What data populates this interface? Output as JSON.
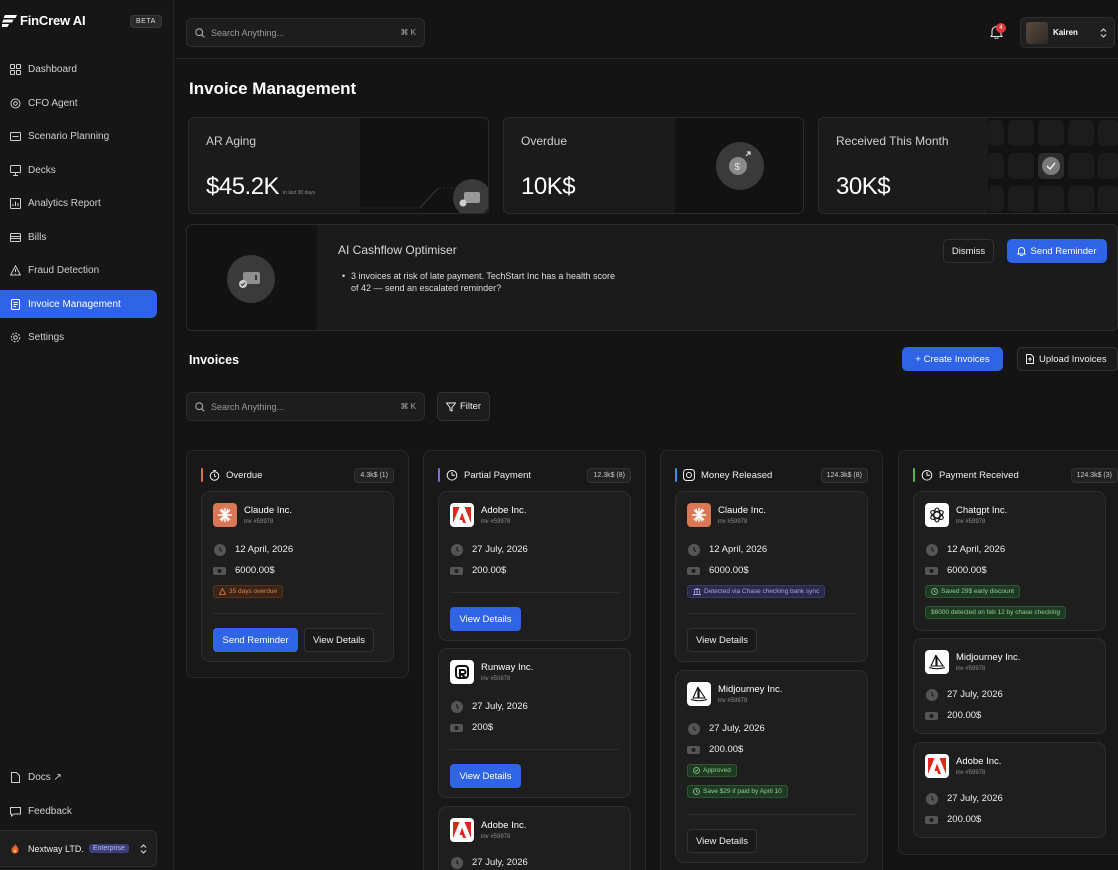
{
  "app": {
    "name": "FinCrew AI",
    "beta": "BETA"
  },
  "sidebar": {
    "items": [
      {
        "label": "Dashboard",
        "icon": "grid-icon"
      },
      {
        "label": "CFO Agent",
        "icon": "agent-icon"
      },
      {
        "label": "Scenario Planning",
        "icon": "scenario-icon"
      },
      {
        "label": "Decks",
        "icon": "presentation-icon"
      },
      {
        "label": "Analytics Report",
        "icon": "analytics-icon"
      },
      {
        "label": "Bills",
        "icon": "wallet-icon"
      },
      {
        "label": "Fraud Detection",
        "icon": "warning-icon"
      },
      {
        "label": "Invoice Management",
        "icon": "invoice-icon",
        "active": true
      },
      {
        "label": "Settings",
        "icon": "gear-icon"
      }
    ],
    "footer": {
      "docs": "Docs ↗",
      "feedback": "Feedback"
    },
    "org": {
      "name": "Nextway LTD.",
      "plan": "Enterprise"
    }
  },
  "topbar": {
    "search_placeholder": "Search Anything...",
    "search_shortcut": "⌘ K",
    "notifications": "4",
    "user": "Kairen"
  },
  "page": {
    "title": "Invoice Management"
  },
  "stats": [
    {
      "label": "AR Aging",
      "value": "$45.2K",
      "sub": "in last 30 days"
    },
    {
      "label": "Overdue",
      "value": "10K$"
    },
    {
      "label": "Received This Month",
      "value": "30K$"
    }
  ],
  "optimiser": {
    "title": "AI Cashflow Optimiser",
    "text": "3 invoices at risk of late payment. TechStart Inc has a health score of 42 — send an escalated reminder?",
    "dismiss": "Dismiss",
    "send": "Send Reminder"
  },
  "invoices": {
    "title": "Invoices",
    "create": "+ Create Invoices",
    "upload": "Upload Invoices",
    "search_placeholder": "Search Anything...",
    "search_shortcut": "⌘ K",
    "filter": "Filter"
  },
  "columns": [
    {
      "title": "Overdue",
      "total": "4.3k$ (1)",
      "color": "#e0732e",
      "cards": [
        {
          "name": "Claude Inc.",
          "inv": "inv #59978",
          "date": "12 April, 2026",
          "amount": "6000.00$",
          "tag": "35 days overdue",
          "primary": "Send Reminder",
          "secondary": "View Details"
        }
      ]
    },
    {
      "title": "Partial Payment",
      "total": "12.3k$ (8)",
      "color": "#7a6fe0",
      "cards": [
        {
          "name": "Adobe Inc.",
          "inv": "inv #59978",
          "date": "27 July, 2026",
          "amount": "200.00$",
          "primary": "View Details"
        },
        {
          "name": "Runway Inc.",
          "inv": "inv #50878",
          "date": "27 July, 2026",
          "amount": "200$",
          "primary": "View Details"
        },
        {
          "name": "Adobe Inc.",
          "inv": "inv #59978",
          "date": "27 July, 2026"
        }
      ]
    },
    {
      "title": "Money Released",
      "total": "124.3k$ (8)",
      "color": "#3a8ee8",
      "cards": [
        {
          "name": "Claude Inc.",
          "inv": "inv #59978",
          "date": "12 April, 2026",
          "amount": "6000.00$",
          "tag": "Detected via Chase checking bank sync",
          "secondary": "View Details"
        },
        {
          "name": "Midjourney Inc.",
          "inv": "inv #59978",
          "date": "27 July, 2026",
          "amount": "200.00$",
          "tag": "Approved",
          "tag2": "Save $29 if paid by April 10",
          "secondary": "View Details"
        }
      ]
    },
    {
      "title": "Payment Received",
      "total": "124.3k$ (3)",
      "color": "#4fb84f",
      "cards": [
        {
          "name": "Chatgpt Inc.",
          "inv": "inv #59978",
          "date": "12 April, 2026",
          "amount": "6000.00$",
          "tag": "Saved 29$ early discount",
          "tag2": "$6000 detected on feb 12 by chase checking"
        },
        {
          "name": "Midjourney Inc.",
          "inv": "inv #59978",
          "date": "27 July, 2026",
          "amount": "200.00$"
        },
        {
          "name": "Adobe Inc.",
          "inv": "inv #59978",
          "date": "27 July, 2026",
          "amount": "200.00$"
        }
      ]
    }
  ]
}
